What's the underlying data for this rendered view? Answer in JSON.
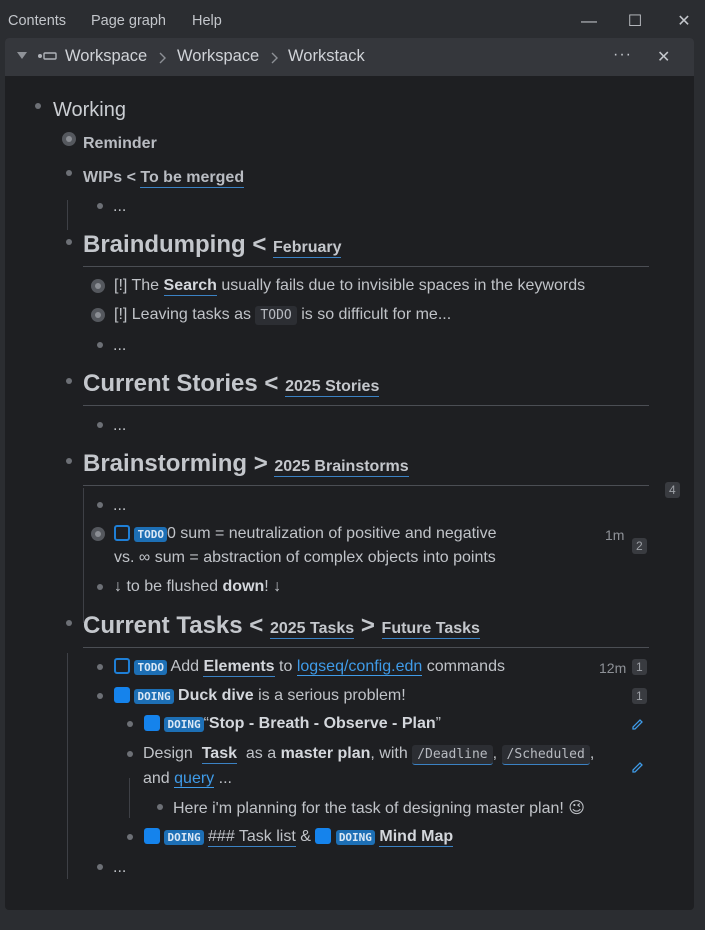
{
  "menubar": {
    "items": [
      "Contents",
      "Page graph",
      "Help"
    ]
  },
  "window": {
    "minimize": "—",
    "maximize": "☐",
    "close": "✕"
  },
  "panel": {
    "breadcrumb": [
      "Workspace",
      "Workspace",
      "Workstack"
    ],
    "more": "···",
    "close": "✕"
  },
  "blocks": {
    "working": "Working",
    "reminder": "Reminder",
    "wips": "WIPs",
    "lt": "<",
    "gt": ">",
    "to_be_merged": "To be merged",
    "ellipsis": "...",
    "braindumping": "Braindumping",
    "february": "February",
    "bd1_prefix": "[!] The",
    "bd1_bold": "Search",
    "bd1_rest": "usually fails due to invisible spaces in the keywords",
    "bd2_prefix": "[!] Leaving tasks as",
    "bd2_code": "TODO",
    "bd2_rest": "is so difficult for me...",
    "current_stories": "Current Stories",
    "stories_2025": "2025 Stories",
    "brainstorming": "Brainstorming",
    "brainstorms_2025": "2025 Brainstorms",
    "brainstorm_count": "4",
    "bs_todo": "TODO",
    "bs_line1": "0 sum = neutralization of positive and negative",
    "bs_line2": "vs. ∞ sum = abstraction of complex objects into points",
    "bs_time": "1m",
    "bs_count": "2",
    "flush_prefix": "↓ to be flushed",
    "flush_bold": "down",
    "flush_suffix": "! ↓",
    "current_tasks": "Current Tasks",
    "tasks_2025": "2025 Tasks",
    "future_tasks": "Future Tasks",
    "t1_todo": "TODO",
    "t1_add": "Add",
    "t1_elements": "Elements",
    "t1_to": "to",
    "t1_link": "logseq/config.edn",
    "t1_commands": "commands",
    "t1_time": "12m",
    "t1_count": "1",
    "t2_doing": "DOING",
    "t2_bold": "Duck dive",
    "t2_rest": "is a serious problem!",
    "t2_count": "1",
    "t3_doing": "DOING",
    "t3_open": "“",
    "t3_bold": "Stop - Breath - Observe - Plan",
    "t3_close": "”",
    "t4_design": "Design",
    "t4_task": "Task",
    "t4_asa": "as a",
    "t4_master": "master plan",
    "t4_with": ", with",
    "t4_deadline": "/Deadline",
    "t4_comma": ",",
    "t4_scheduled": "/Scheduled",
    "t4_and": "and",
    "t4_query": "query",
    "t4_dots": "...",
    "t5_text": "Here i'm planning for the task of designing master plan! 😉",
    "t6_doing": "DOING",
    "t6_task": "### Task list",
    "t6_amp": "&",
    "t6_doing2": "DOING",
    "t6_mind": "Mind Map"
  },
  "colors": {
    "background": "#1e1f22",
    "accent": "#1f7fd6",
    "link": "#3f9be8"
  }
}
